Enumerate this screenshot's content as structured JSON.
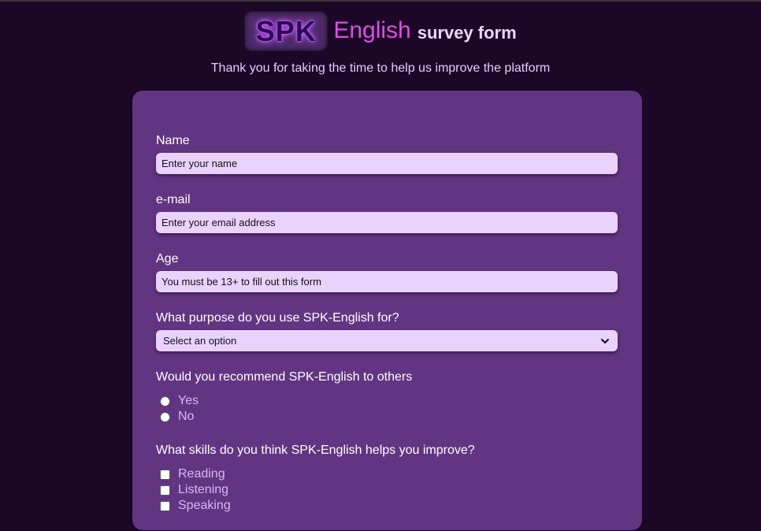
{
  "header": {
    "logo_spk": "SPK",
    "logo_english": "English",
    "logo_survey": "survey form",
    "subtitle": "Thank you for taking the time to help us improve the platform"
  },
  "form": {
    "name": {
      "label": "Name",
      "placeholder": "Enter your name"
    },
    "email": {
      "label": "e-mail",
      "placeholder": "Enter your email address"
    },
    "age": {
      "label": "Age",
      "placeholder": "You must be 13+ to fill out this form"
    },
    "purpose": {
      "label": "What purpose do you use SPK-English for?",
      "selected": "Select an option"
    },
    "recommend": {
      "label": "Would you recommend SPK-English to others",
      "options": [
        "Yes",
        "No"
      ]
    },
    "skills": {
      "label": "What skills do you think SPK-English helps you improve?",
      "options": [
        "Reading",
        "Listening",
        "Speaking"
      ]
    }
  },
  "colors": {
    "page_bg": "#1c0727",
    "card_bg": "#623582",
    "input_bg": "#ead2ff",
    "accent_pink": "#e04de6"
  },
  "icons": {
    "select_arrow": "chevron-down-icon"
  }
}
